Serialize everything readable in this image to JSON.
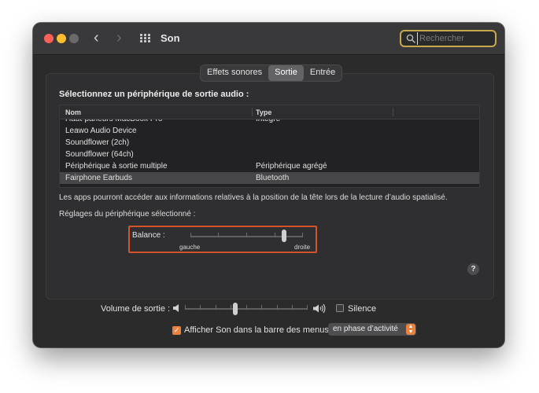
{
  "window": {
    "title": "Son"
  },
  "search": {
    "placeholder": "Rechercher"
  },
  "tabs": [
    {
      "label": "Effets sonores",
      "active": false
    },
    {
      "label": "Sortie",
      "active": true
    },
    {
      "label": "Entrée",
      "active": false
    }
  ],
  "output": {
    "section_title": "Sélectionnez un périphérique de sortie audio :",
    "columns": {
      "name": "Nom",
      "type": "Type"
    },
    "devices": [
      {
        "name": "Haut-parleurs MacBook Pro",
        "type": "Intégré"
      },
      {
        "name": "Leawo Audio Device",
        "type": ""
      },
      {
        "name": "Soundflower (2ch)",
        "type": ""
      },
      {
        "name": "Soundflower (64ch)",
        "type": ""
      },
      {
        "name": "Périphérique à sortie multiple",
        "type": "Périphérique agrégé"
      },
      {
        "name": "Fairphone Earbuds",
        "type": "Bluetooth",
        "selected": true
      }
    ],
    "info_text": "Les apps pourront accéder aux informations relatives à la position de la tête lors de la lecture d’audio spatialisé.",
    "settings_title": "Réglages du périphérique sélectionné :",
    "balance": {
      "label": "Balance :",
      "left_label": "gauche",
      "right_label": "droite",
      "value": 0.83
    }
  },
  "footer": {
    "volume_label": "Volume de sortie :",
    "volume_value": 0.41,
    "silence_label": "Silence",
    "silence_checked": false,
    "menu_checkbox_label": "Afficher Son dans la barre des menus",
    "menu_checkbox_checked": true,
    "menu_popup_value": "en phase d’activité"
  },
  "colors": {
    "highlight_border": "#d2542f",
    "accent_orange": "#e8823f",
    "search_focus": "#c9a84d"
  },
  "icons": {
    "back": "chevron-left-icon",
    "forward": "chevron-right-icon",
    "grid": "grid-icon",
    "search": "magnifier-icon",
    "volume_low": "speaker-low-icon",
    "volume_high": "speaker-high-icon",
    "help": "question-icon"
  }
}
